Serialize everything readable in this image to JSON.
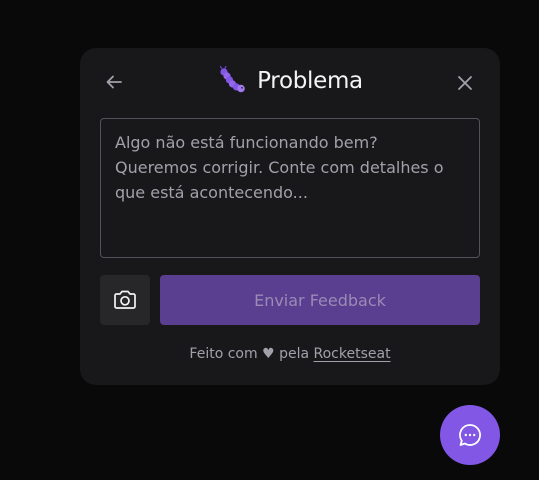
{
  "widget": {
    "title": "Problema",
    "type_icon": "caterpillar-bug-icon",
    "back_icon": "arrow-left-icon",
    "close_icon": "close-icon",
    "placeholder": "Algo não está funcionando bem? Queremos corrigir. Conte com detalhes o que está acontecendo...",
    "screenshot_icon": "camera-icon",
    "submit_label": "Enviar Feedback",
    "footer_prefix": "Feito com",
    "footer_heart": "♥",
    "footer_middle": "pela",
    "footer_link": "Rocketseat"
  },
  "fab": {
    "icon": "chat-bubble-icon"
  },
  "colors": {
    "background": "#09090a",
    "card": "#18181b",
    "brand": "#8257e5",
    "button_disabled": "#5a3e90",
    "text": "#f4f4f5",
    "muted": "#a1a1aa"
  }
}
